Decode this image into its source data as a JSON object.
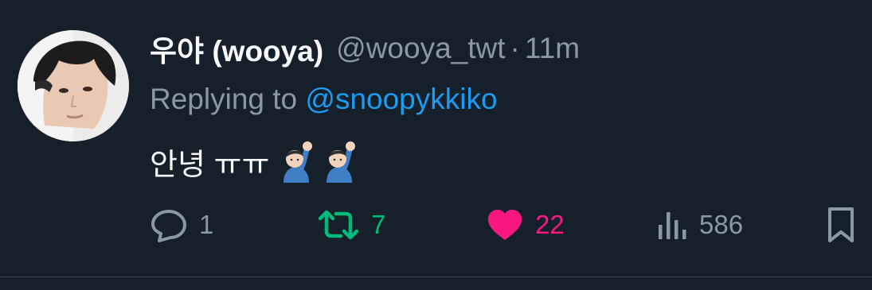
{
  "tweet": {
    "display_name": "우야 (wooya)",
    "handle": "@wooya_twt",
    "separator": "·",
    "time": "11m",
    "replying_prefix": "Replying to",
    "replying_to": "@snoopykkiko",
    "text": "안녕 ㅠㅠ",
    "emoji_icon": "person-raising-hand-emoji",
    "emoji_count": 2
  },
  "actions": {
    "replies": "1",
    "retweets": "7",
    "likes": "22",
    "views": "586",
    "liked": true
  },
  "colors": {
    "background": "#15202b",
    "muted": "#8b98a5",
    "mention": "#1d9bf0",
    "retweet": "#00ba7c",
    "like": "#f91880"
  }
}
